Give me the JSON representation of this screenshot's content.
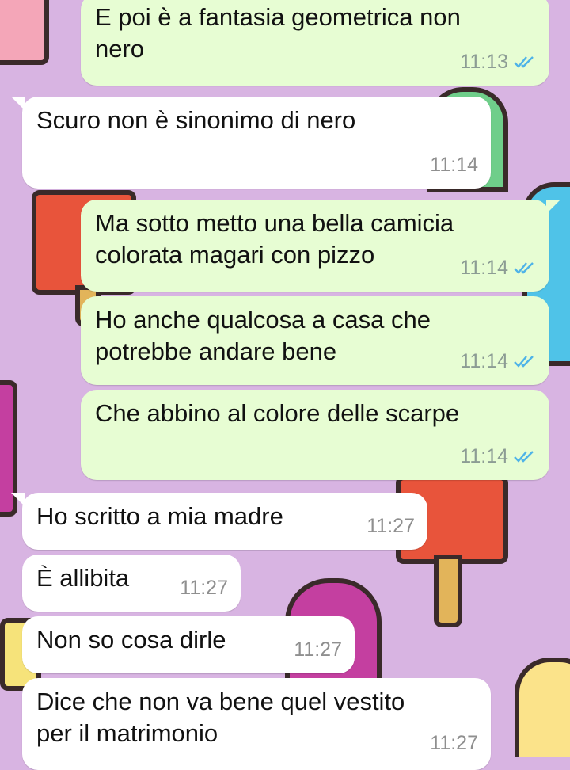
{
  "colors": {
    "wallpaper": "#d8b4e2",
    "outgoing_bubble": "#e7fdd3",
    "incoming_bubble": "#ffffff",
    "read_ticks": "#4fb3e8"
  },
  "messages": [
    {
      "direction": "out",
      "text": "E poi è a fantasia geometrica non\nnero",
      "time": "11:13",
      "status_icon": "double-check-read"
    },
    {
      "direction": "in",
      "text": "Scuro non è sinonimo di nero",
      "time": "11:14"
    },
    {
      "direction": "out",
      "text": "Ma sotto metto una bella camicia\ncolorata magari con pizzo",
      "time": "11:14",
      "status_icon": "double-check-read"
    },
    {
      "direction": "out",
      "text": "Ho anche qualcosa a casa che\npotrebbe andare bene",
      "time": "11:14",
      "status_icon": "double-check-read"
    },
    {
      "direction": "out",
      "text": "Che abbino al colore delle scarpe",
      "time": "11:14",
      "status_icon": "double-check-read"
    },
    {
      "direction": "in",
      "text": "Ho scritto a mia madre",
      "time": "11:27"
    },
    {
      "direction": "in",
      "text": "È allibita",
      "time": "11:27"
    },
    {
      "direction": "in",
      "text": "Non so cosa dirle",
      "time": "11:27"
    },
    {
      "direction": "in",
      "text": "Dice che non va bene quel vestito\nper il matrimonio",
      "time": "11:27"
    }
  ]
}
